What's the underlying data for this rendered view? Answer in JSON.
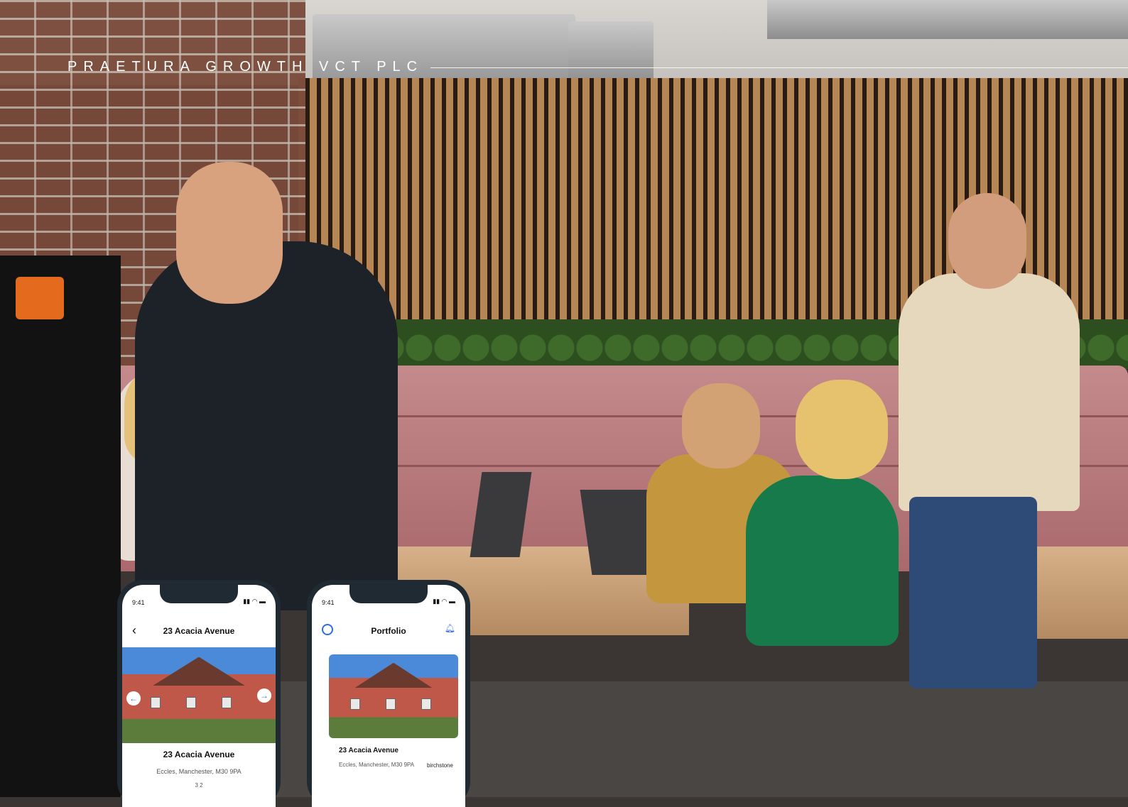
{
  "brand": {
    "title": "PRAETURA GROWTH VCT PLC"
  },
  "phone_left": {
    "time": "9:41",
    "nav_title": "23 Acacia Avenue",
    "card_title": "23 Acacia Avenue",
    "card_address": "Eccles, Manchester, M30 9PA",
    "card_meta": "3  2"
  },
  "phone_right": {
    "time": "9:41",
    "nav_title": "Portfolio",
    "card_title": "23 Acacia Avenue",
    "card_address": "Eccles, Manchester, M30 9PA",
    "partner_logo": "birchstone"
  },
  "colors": {
    "accent_blue": "#2e6de6",
    "text_white": "#ffffff"
  }
}
